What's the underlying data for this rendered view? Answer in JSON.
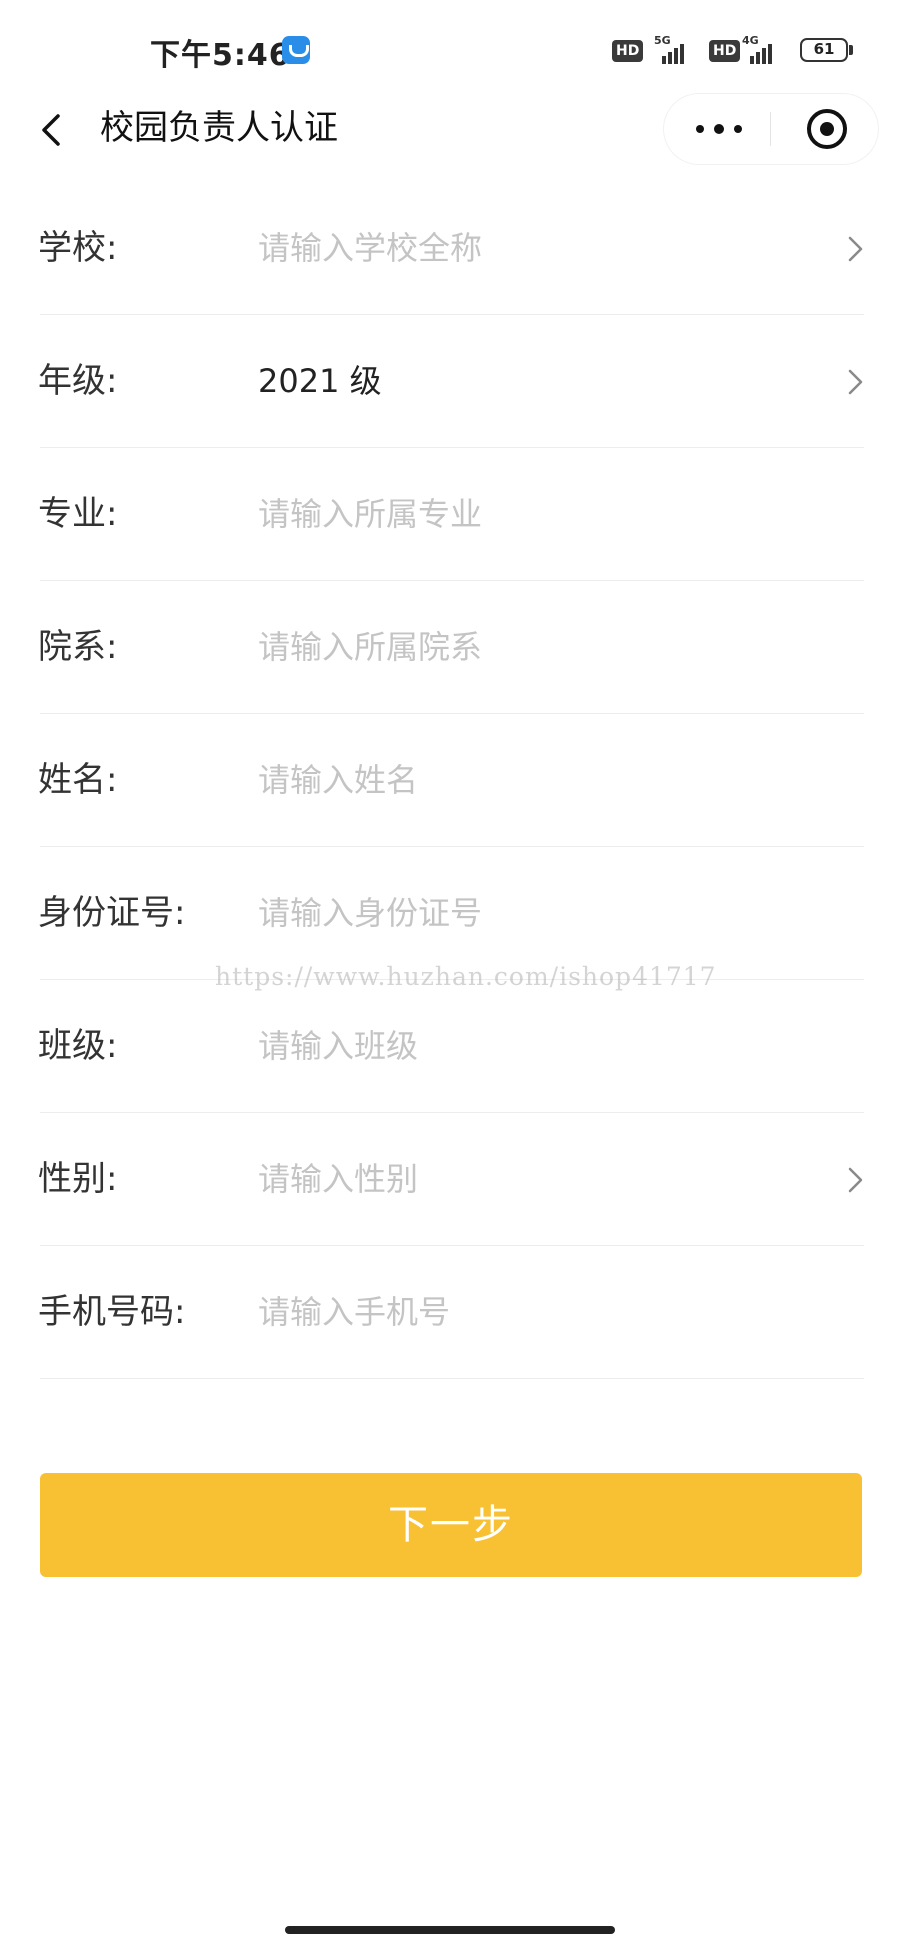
{
  "status_bar": {
    "time": "下午5:46",
    "hd_label_1": "HD",
    "network_1": "5G",
    "hd_label_2": "HD",
    "network_2": "4G",
    "battery": "61"
  },
  "nav": {
    "title": "校园负责人认证"
  },
  "form": {
    "rows": [
      {
        "label": "学校:",
        "placeholder": "请输入学校全称",
        "has_chevron": true
      },
      {
        "label": "年级:",
        "value": "2021 级",
        "has_chevron": true
      },
      {
        "label": "专业:",
        "placeholder": "请输入所属专业",
        "has_chevron": false
      },
      {
        "label": "院系:",
        "placeholder": "请输入所属院系",
        "has_chevron": false
      },
      {
        "label": "姓名:",
        "placeholder": "请输入姓名",
        "has_chevron": false
      },
      {
        "label": "身份证号:",
        "placeholder": "请输入身份证号",
        "has_chevron": false
      },
      {
        "label": "班级:",
        "placeholder": "请输入班级",
        "has_chevron": false
      },
      {
        "label": "性别:",
        "placeholder": "请输入性别",
        "has_chevron": true
      },
      {
        "label": "手机号码:",
        "placeholder": "请输入手机号",
        "has_chevron": false
      }
    ]
  },
  "watermark": "https://www.huzhan.com/ishop41717",
  "next_button": {
    "label": "下一步"
  },
  "colors": {
    "accent": "#f8c033",
    "placeholder": "#c4c4c4",
    "label": "#333333"
  }
}
